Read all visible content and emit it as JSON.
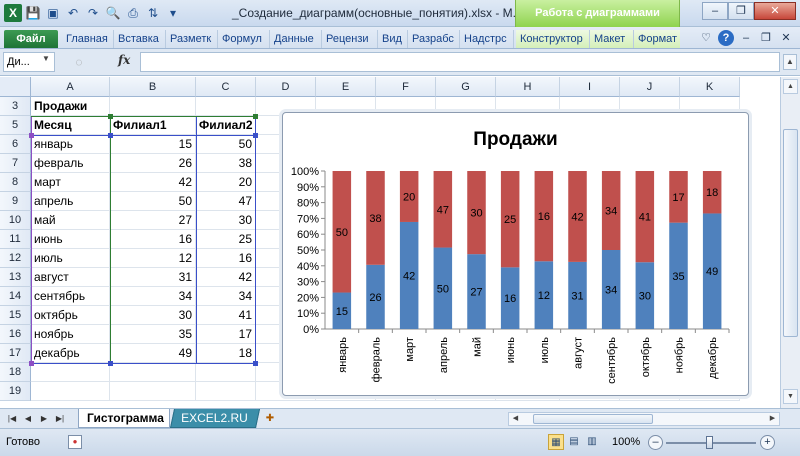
{
  "titlebar": {
    "title": "_Создание_диаграмм(основные_понятия).xlsx - M...",
    "context_tools": "Работа с диаграммами",
    "win_minimize": "–",
    "win_restore": "❐",
    "win_close": "✕"
  },
  "ribbon": {
    "tabs": [
      "Файл",
      "Главная",
      "Вставка",
      "Разметк",
      "Формул",
      "Данные",
      "Рецензи",
      "Вид",
      "Разрабс",
      "Надстрс"
    ],
    "context_tabs": [
      "Конструктор",
      "Макет",
      "Формат"
    ]
  },
  "formula_bar": {
    "name_box": "Ди...",
    "fx_label": "fx",
    "value": ""
  },
  "grid": {
    "columns": [
      "A",
      "B",
      "C",
      "D",
      "E",
      "F",
      "G",
      "H",
      "I",
      "J",
      "K"
    ],
    "rows": [
      "3",
      "5",
      "6",
      "7",
      "8",
      "9",
      "10",
      "11",
      "12",
      "13",
      "14",
      "15",
      "16",
      "17",
      "18",
      "19"
    ],
    "title_cell": "Продажи",
    "headers": [
      "Месяц",
      "Филиал1",
      "Филиал2"
    ],
    "data": [
      [
        "январь",
        "15",
        "50"
      ],
      [
        "февраль",
        "26",
        "38"
      ],
      [
        "март",
        "42",
        "20"
      ],
      [
        "апрель",
        "50",
        "47"
      ],
      [
        "май",
        "27",
        "30"
      ],
      [
        "июнь",
        "16",
        "25"
      ],
      [
        "июль",
        "12",
        "16"
      ],
      [
        "август",
        "31",
        "42"
      ],
      [
        "сентябрь",
        "34",
        "34"
      ],
      [
        "октябрь",
        "30",
        "41"
      ],
      [
        "ноябрь",
        "35",
        "17"
      ],
      [
        "декабрь",
        "49",
        "18"
      ]
    ]
  },
  "chart_data": {
    "type": "bar",
    "stacking": "percent",
    "title": "Продажи",
    "categories": [
      "январь",
      "февраль",
      "март",
      "апрель",
      "май",
      "июнь",
      "июль",
      "август",
      "сентябрь",
      "октябрь",
      "ноябрь",
      "декабрь"
    ],
    "series": [
      {
        "values": [
          15,
          26,
          42,
          50,
          27,
          16,
          12,
          31,
          34,
          30,
          35,
          49
        ],
        "color": "#4f81bd"
      },
      {
        "values": [
          50,
          38,
          20,
          47,
          30,
          25,
          16,
          42,
          34,
          41,
          17,
          18
        ],
        "color": "#c0504d"
      }
    ],
    "y_ticks": [
      "0%",
      "10%",
      "20%",
      "30%",
      "40%",
      "50%",
      "60%",
      "70%",
      "80%",
      "90%",
      "100%"
    ],
    "ylim": [
      0,
      100
    ],
    "grid": false,
    "legend": "none"
  },
  "sheets": {
    "active": "Гистограмма",
    "other": "EXCEL2.RU"
  },
  "status": {
    "text": "Готово",
    "zoom": "100%"
  }
}
